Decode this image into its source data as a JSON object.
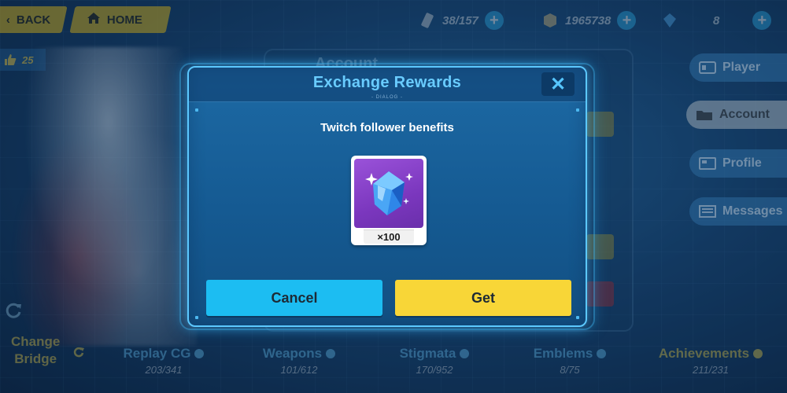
{
  "top_bar": {
    "back_label": "BACK",
    "home_label": "HOME",
    "stamina": "38/157",
    "coins": "1965738",
    "crystals": "8",
    "likes": "25"
  },
  "background_panel": {
    "title": "Account"
  },
  "side_nav": {
    "items": [
      {
        "label": "Player"
      },
      {
        "label": "Account"
      },
      {
        "label": "Profile"
      },
      {
        "label": "Messages"
      }
    ]
  },
  "bottom_bar": {
    "change_bridge_line1": "Change",
    "change_bridge_line2": "Bridge",
    "items": [
      {
        "label": "Replay CG",
        "count": "203/341"
      },
      {
        "label": "Weapons",
        "count": "101/612"
      },
      {
        "label": "Stigmata",
        "count": "170/952"
      },
      {
        "label": "Emblems",
        "count": "8/75"
      },
      {
        "label": "Achievements",
        "count": "211/231"
      }
    ]
  },
  "dialog": {
    "title": "Exchange Rewards",
    "subtitle": "- DIALOG -",
    "close_symbol": "✕",
    "body_title": "Twitch follower benefits",
    "reward": {
      "icon": "crystal-icon",
      "quantity": "×100"
    },
    "cancel_label": "Cancel",
    "get_label": "Get"
  },
  "colors": {
    "title_blue": "#69ccff",
    "cancel_blue": "#1cbdf2",
    "get_yellow": "#f8d637",
    "reward_purple": "#9a52d9",
    "top_button_gold": "#d9b51c"
  }
}
